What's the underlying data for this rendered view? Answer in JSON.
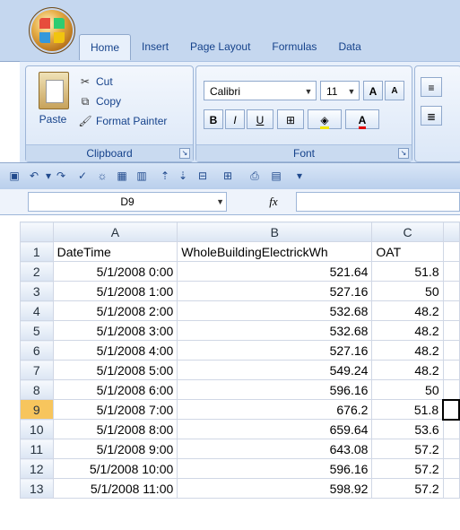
{
  "ribbon": {
    "tabs": [
      "Home",
      "Insert",
      "Page Layout",
      "Formulas",
      "Data"
    ],
    "active_tab": "Home",
    "clipboard": {
      "label": "Clipboard",
      "paste": "Paste",
      "cut": "Cut",
      "copy": "Copy",
      "format_painter": "Format Painter"
    },
    "font": {
      "label": "Font",
      "family": "Calibri",
      "size": "11",
      "bold": "B",
      "italic": "I",
      "underline": "U",
      "grow": "A",
      "shrink": "A"
    }
  },
  "formula_bar": {
    "name_box": "D9",
    "fx": "fx",
    "value": ""
  },
  "sheet": {
    "columns": [
      "A",
      "B",
      "C"
    ],
    "rows": [
      {
        "n": "1",
        "a": "DateTime",
        "b": "WholeBuildingElectrickWh",
        "c": "OAT"
      },
      {
        "n": "2",
        "a": "5/1/2008 0:00",
        "b": "521.64",
        "c": "51.8"
      },
      {
        "n": "3",
        "a": "5/1/2008 1:00",
        "b": "527.16",
        "c": "50"
      },
      {
        "n": "4",
        "a": "5/1/2008 2:00",
        "b": "532.68",
        "c": "48.2"
      },
      {
        "n": "5",
        "a": "5/1/2008 3:00",
        "b": "532.68",
        "c": "48.2"
      },
      {
        "n": "6",
        "a": "5/1/2008 4:00",
        "b": "527.16",
        "c": "48.2"
      },
      {
        "n": "7",
        "a": "5/1/2008 5:00",
        "b": "549.24",
        "c": "48.2"
      },
      {
        "n": "8",
        "a": "5/1/2008 6:00",
        "b": "596.16",
        "c": "50"
      },
      {
        "n": "9",
        "a": "5/1/2008 7:00",
        "b": "676.2",
        "c": "51.8"
      },
      {
        "n": "10",
        "a": "5/1/2008 8:00",
        "b": "659.64",
        "c": "53.6"
      },
      {
        "n": "11",
        "a": "5/1/2008 9:00",
        "b": "643.08",
        "c": "57.2"
      },
      {
        "n": "12",
        "a": "5/1/2008 10:00",
        "b": "596.16",
        "c": "57.2"
      },
      {
        "n": "13",
        "a": "5/1/2008 11:00",
        "b": "598.92",
        "c": "57.2"
      }
    ]
  }
}
